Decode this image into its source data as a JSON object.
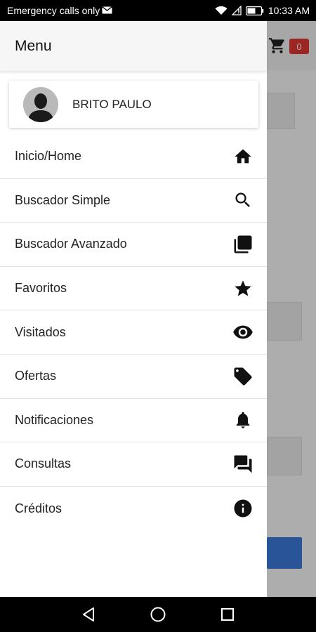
{
  "status_bar": {
    "carrier_text": "Emergency calls only",
    "time": "10:33 AM"
  },
  "app": {
    "cart_badge": "0"
  },
  "drawer": {
    "title": "Menu",
    "user_name": "BRITO PAULO",
    "items": [
      {
        "label": "Inicio/Home",
        "icon": "home-icon"
      },
      {
        "label": "Buscador Simple",
        "icon": "search-icon"
      },
      {
        "label": "Buscador Avanzado",
        "icon": "library-icon"
      },
      {
        "label": "Favoritos",
        "icon": "star-icon"
      },
      {
        "label": "Visitados",
        "icon": "eye-icon"
      },
      {
        "label": "Ofertas",
        "icon": "tags-icon"
      },
      {
        "label": "Notificaciones",
        "icon": "bell-icon"
      },
      {
        "label": "Consultas",
        "icon": "chat-icon"
      },
      {
        "label": "Créditos",
        "icon": "info-icon"
      }
    ]
  },
  "colors": {
    "badge": "#e53935",
    "accent_button": "#3f7de0"
  }
}
